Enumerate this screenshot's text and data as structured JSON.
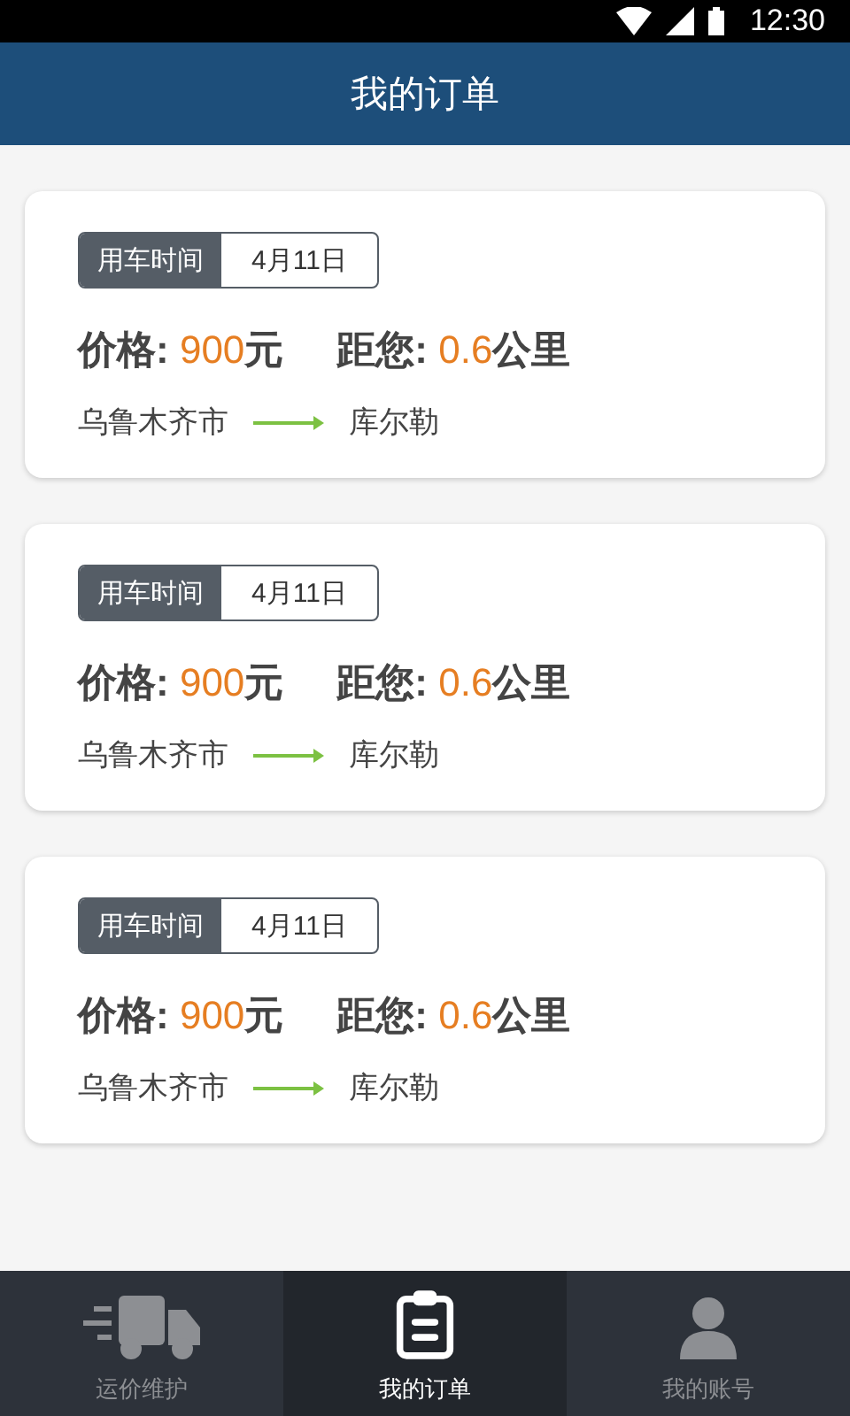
{
  "status_bar": {
    "time": "12:30"
  },
  "header": {
    "title": "我的订单"
  },
  "orders": [
    {
      "time_label": "用车时间",
      "date": "4月11日",
      "price_label": "价格:",
      "price_value": "900",
      "price_unit": "元",
      "distance_label": "距您:",
      "distance_value": "0.6",
      "distance_unit": "公里",
      "from": "乌鲁木齐市",
      "to": "库尔勒"
    },
    {
      "time_label": "用车时间",
      "date": "4月11日",
      "price_label": "价格:",
      "price_value": "900",
      "price_unit": "元",
      "distance_label": "距您:",
      "distance_value": "0.6",
      "distance_unit": "公里",
      "from": "乌鲁木齐市",
      "to": "库尔勒"
    },
    {
      "time_label": "用车时间",
      "date": "4月11日",
      "price_label": "价格:",
      "price_value": "900",
      "price_unit": "元",
      "distance_label": "距您:",
      "distance_value": "0.6",
      "distance_unit": "公里",
      "from": "乌鲁木齐市",
      "to": "库尔勒"
    }
  ],
  "tabs": [
    {
      "label": "运价维护",
      "kind": "truck",
      "selected": false
    },
    {
      "label": "我的订单",
      "kind": "clipboard",
      "selected": true
    },
    {
      "label": "我的账号",
      "kind": "person",
      "selected": false
    }
  ]
}
